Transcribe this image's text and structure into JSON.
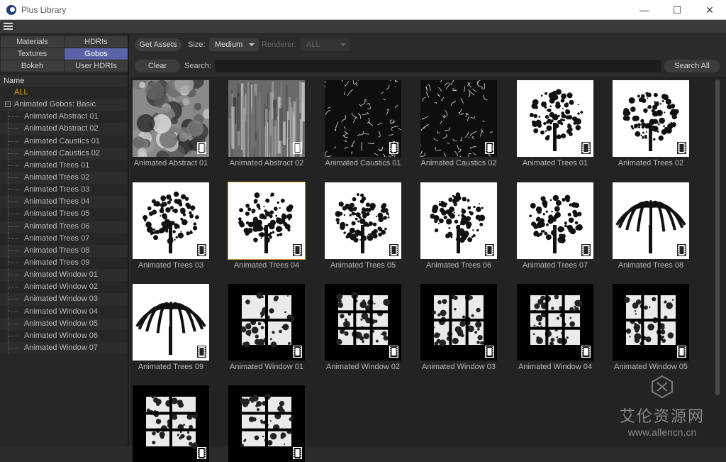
{
  "window": {
    "title": "Plus Library"
  },
  "window_buttons": [
    "—",
    "☐",
    "✕"
  ],
  "menu": {
    "icon": "hamburger-menu-icon"
  },
  "tabs": [
    {
      "label": "Materials",
      "active": false
    },
    {
      "label": "HDRIs",
      "active": false
    },
    {
      "label": "Textures",
      "active": false
    },
    {
      "label": "Gobos",
      "active": true
    },
    {
      "label": "Bokeh",
      "active": false
    },
    {
      "label": "User HDRIs",
      "active": false
    }
  ],
  "tree": {
    "header": "Name",
    "all_label": "ALL",
    "group_label": "Animated Gobos: Basic",
    "items": [
      "Animated Abstract 01",
      "Animated Abstract 02",
      "Animated Caustics 01",
      "Animated Caustics 02",
      "Animated Trees 01",
      "Animated Trees 02",
      "Animated Trees 03",
      "Animated Trees 04",
      "Animated Trees 05",
      "Animated Trees 06",
      "Animated Trees 07",
      "Animated Trees 08",
      "Animated Trees 09",
      "Animated Window 01",
      "Animated Window 02",
      "Animated Window 03",
      "Animated Window 04",
      "Animated Window 05",
      "Animated Window 06",
      "Animated Window 07"
    ]
  },
  "toolbar": {
    "get_assets": "Get Assets",
    "size_label": "Size:",
    "size_value": "Medium",
    "renderer_label": "Renderer:",
    "renderer_value": "ALL",
    "clear": "Clear",
    "search_label": "Search:",
    "search_value": "",
    "search_all": "Search All"
  },
  "assets": [
    {
      "name": "Animated Abstract 01",
      "kind": "abstract1"
    },
    {
      "name": "Animated Abstract 02",
      "kind": "abstract2"
    },
    {
      "name": "Animated Caustics 01",
      "kind": "caustics"
    },
    {
      "name": "Animated Caustics 02",
      "kind": "caustics"
    },
    {
      "name": "Animated Trees 01",
      "kind": "tree"
    },
    {
      "name": "Animated Trees 02",
      "kind": "tree"
    },
    {
      "name": "Animated Trees 03",
      "kind": "tree"
    },
    {
      "name": "Animated Trees 04",
      "kind": "tree",
      "selected": true
    },
    {
      "name": "Animated Trees 05",
      "kind": "tree"
    },
    {
      "name": "Animated Trees 06",
      "kind": "tree"
    },
    {
      "name": "Animated Trees 07",
      "kind": "tree"
    },
    {
      "name": "Animated Trees 08",
      "kind": "palm"
    },
    {
      "name": "Animated Trees 09",
      "kind": "palm"
    },
    {
      "name": "Animated Window 01",
      "kind": "window"
    },
    {
      "name": "Animated Window 02",
      "kind": "window"
    },
    {
      "name": "Animated Window 03",
      "kind": "window"
    },
    {
      "name": "Animated Window 04",
      "kind": "window"
    },
    {
      "name": "Animated Window 05",
      "kind": "window"
    },
    {
      "name": "Animated Window 06",
      "kind": "window"
    },
    {
      "name": "Animated Window 07",
      "kind": "window"
    }
  ],
  "watermark": {
    "cn": "艾伦资源网",
    "url": "www.allencn.cn"
  }
}
